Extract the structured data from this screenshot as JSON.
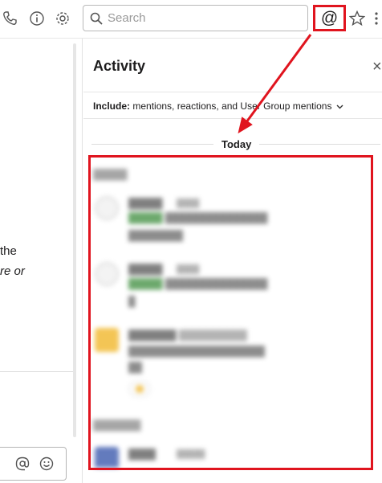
{
  "toolbar": {
    "icons": [
      "phone-icon",
      "info-icon",
      "gear-icon",
      "star-icon",
      "more-icon"
    ],
    "search_placeholder": "Search",
    "mentions_symbol": "@"
  },
  "left_pane": {
    "text_line1": "the",
    "text_line2": "re or",
    "composer_icons": [
      "at-icon",
      "emoji-icon"
    ]
  },
  "activity": {
    "title": "Activity",
    "close_symbol": "×",
    "filter_label": "Include:",
    "filter_value": "mentions, reactions, and User Group mentions",
    "day_label": "Today"
  },
  "colors": {
    "annotation_red": "#e0141e",
    "mention_tag_green": "#3c8c3c"
  }
}
